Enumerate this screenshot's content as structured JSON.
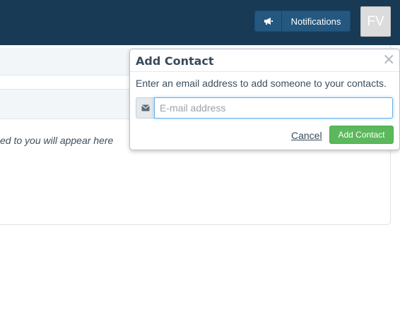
{
  "header": {
    "notifications_label": "Notifications",
    "avatar_initials": "FV",
    "bg_color": "#183a55"
  },
  "background": {
    "empty_text": "ed to you will appear here"
  },
  "popover": {
    "title": "Add Contact",
    "close_glyph": "×",
    "description": "Enter an email address to add someone to your contacts.",
    "email_placeholder": "E-mail address",
    "email_value": "",
    "cancel_label": "Cancel",
    "submit_label": "Add Contact",
    "submit_color": "#5cb85c"
  },
  "icons": {
    "notifications": "megaphone-icon",
    "email": "envelope-icon",
    "close": "close-icon"
  }
}
